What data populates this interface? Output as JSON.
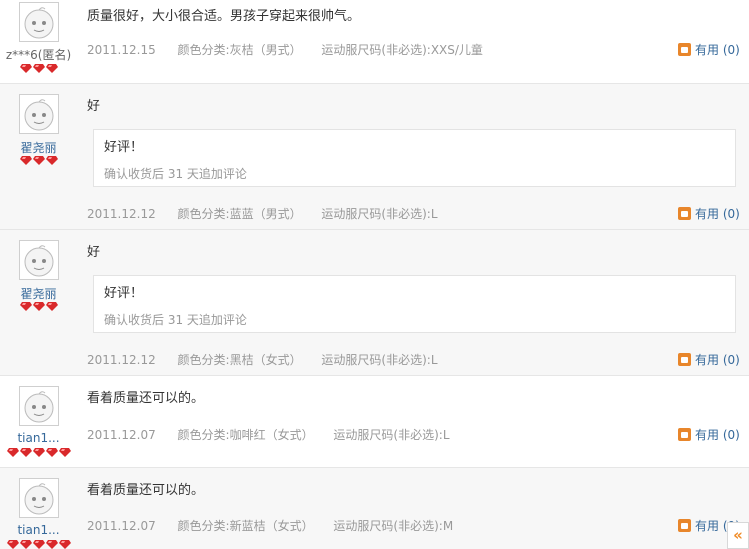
{
  "reviews": [
    {
      "user": "z***6(匿名)",
      "rank_gems": 3,
      "content": "质量很好，大小很合适。男孩子穿起来很帅气。",
      "date": "2011.12.15",
      "color": "颜色分类:灰桔（男式）",
      "size": "运动服尺码(非必选):XXS/儿童",
      "useful_label": "有用",
      "useful_count": "(0)"
    },
    {
      "user": "翟尧丽",
      "rank_gems": 3,
      "content": "好",
      "append_text": "好评！",
      "append_note": "确认收货后 31 天追加评论",
      "date": "2011.12.12",
      "color": "颜色分类:蓝蓝（男式）",
      "size": "运动服尺码(非必选):L",
      "useful_label": "有用",
      "useful_count": "(0)"
    },
    {
      "user": "翟尧丽",
      "rank_gems": 3,
      "content": "好",
      "append_text": "好评！",
      "append_note": "确认收货后 31 天追加评论",
      "date": "2011.12.12",
      "color": "颜色分类:黑桔（女式）",
      "size": "运动服尺码(非必选):L",
      "useful_label": "有用",
      "useful_count": "(0)"
    },
    {
      "user": "tian1...",
      "rank_gems": 5,
      "content": "看着质量还可以的。",
      "date": "2011.12.07",
      "color": "颜色分类:咖啡红（女式）",
      "size": "运动服尺码(非必选):L",
      "useful_label": "有用",
      "useful_count": "(0)"
    },
    {
      "user": "tian1...",
      "rank_gems": 5,
      "content": "看着质量还可以的。",
      "date": "2011.12.07",
      "color": "颜色分类:新蓝桔（女式）",
      "size": "运动服尺码(非必选):M",
      "useful_label": "有用",
      "useful_count": "(0)"
    }
  ],
  "collapse_glyph": "«",
  "colors": {
    "link": "#35689a",
    "meta": "#999999",
    "accent": "#e8862b",
    "gem": "#d9292b"
  }
}
